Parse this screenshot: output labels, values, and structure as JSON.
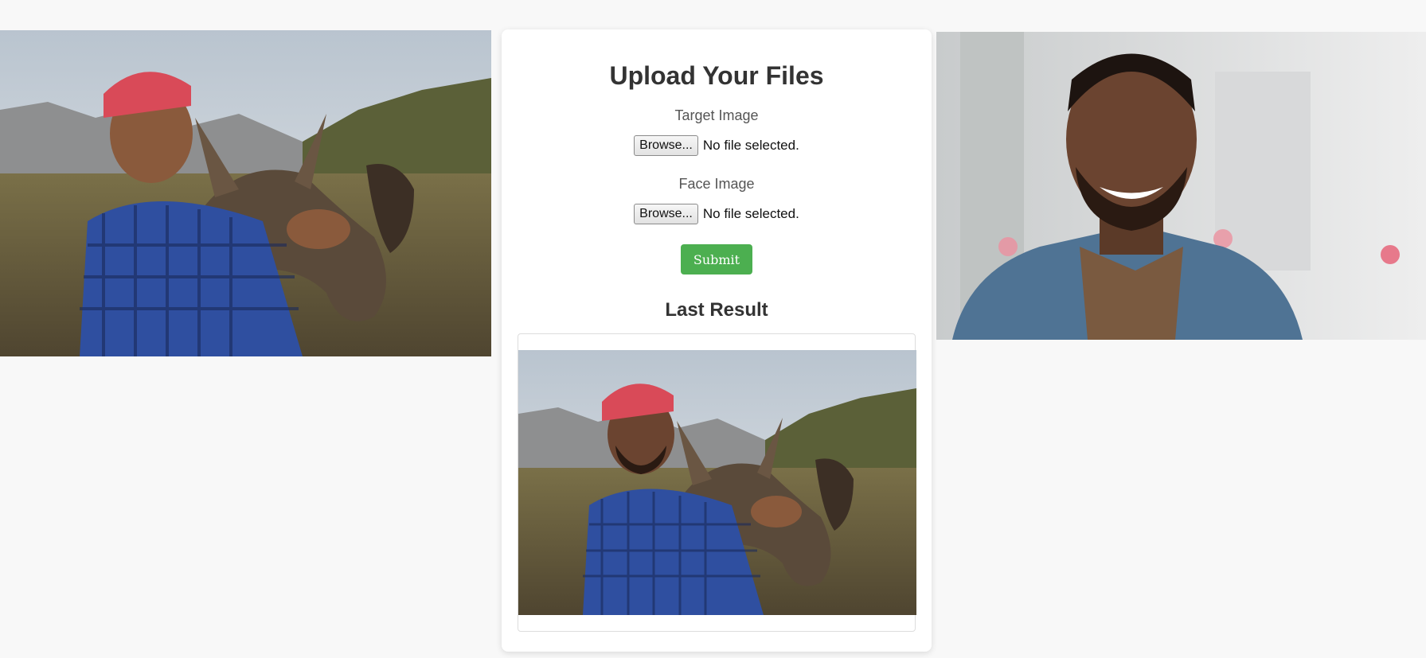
{
  "images": {
    "target": {
      "alt": "Boy in red cap and blue plaid shirt hugging donkeys in a mountain field",
      "icon": "target-photo"
    },
    "face": {
      "alt": "Smiling bearded man in denim shirt",
      "icon": "face-photo"
    },
    "result": {
      "alt": "Face-swapped result image",
      "icon": "result-photo"
    }
  },
  "card": {
    "title": "Upload Your Files",
    "target_label": "Target Image",
    "face_label": "Face Image",
    "browse_label": "Browse...",
    "no_file_text": "No file selected.",
    "submit_label": "Submit",
    "result_heading": "Last Result"
  },
  "colors": {
    "submit": "#4caf50",
    "arrow": "#e8202a",
    "background": "#f8f8f8",
    "card": "#ffffff"
  }
}
